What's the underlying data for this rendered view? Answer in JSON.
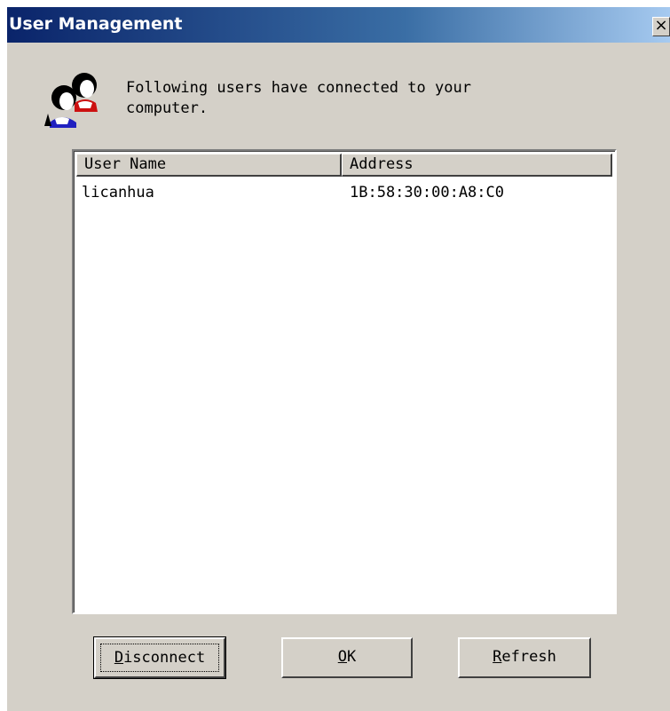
{
  "window": {
    "title": "User Management",
    "close_glyph": "×"
  },
  "dialog": {
    "icon": "users-icon",
    "message_line1": "Following users have connected to your",
    "message_line2": "computer."
  },
  "list": {
    "columns": [
      "User Name",
      "Address"
    ],
    "rows": [
      {
        "user": "licanhua",
        "address": "1B:58:30:00:A8:C0"
      }
    ]
  },
  "buttons": {
    "disconnect": {
      "mnemonic": "D",
      "rest": "isconnect"
    },
    "ok": {
      "mnemonic": "O",
      "rest": "K"
    },
    "refresh": {
      "mnemonic": "R",
      "rest": "efresh"
    }
  },
  "colors": {
    "titlebar_start": "#0a246a",
    "titlebar_end": "#a6caf0",
    "face": "#d4d0c8"
  }
}
